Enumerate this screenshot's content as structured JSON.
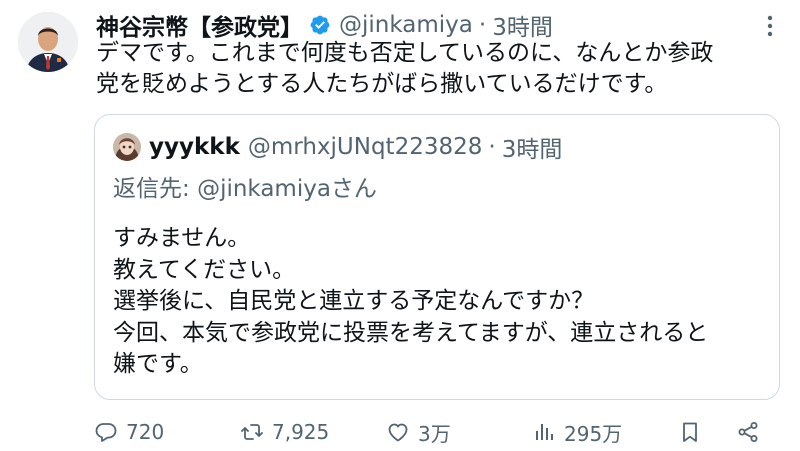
{
  "tweet": {
    "author_name": "神谷宗幣【参政党】",
    "handle": "@jinkamiya",
    "separator": "·",
    "time": "3時間",
    "text_lines": [
      "デマです。これまで何度も否定しているのに、なんとか参政",
      "党を貶めようとする人たちがばら撒いているだけです。"
    ]
  },
  "quote": {
    "author_name": "yyykkk",
    "handle": "@mrhxjUNqt223828",
    "separator": "·",
    "time": "3時間",
    "reply_prefix": "返信先: ",
    "reply_to": "@jinkamiyaさん",
    "text_lines": [
      "すみません。",
      "教えてください。",
      "選挙後に、自民党と連立する予定なんですか？",
      "今回、本気で参政党に投票を考えてますが、連立されると",
      "嫌です。"
    ]
  },
  "actions": {
    "reply_count": "720",
    "retweet_count": "7,925",
    "like_count": "3万",
    "view_count": "295万"
  },
  "colors": {
    "verified": "#1d9bf0",
    "muted": "#536471",
    "border": "#cfd9de"
  },
  "icons": {
    "verified": "verified-badge-icon",
    "more": "more-icon",
    "reply": "reply-icon",
    "retweet": "retweet-icon",
    "like": "heart-icon",
    "views": "views-icon",
    "bookmark": "bookmark-icon",
    "share": "share-icon"
  }
}
